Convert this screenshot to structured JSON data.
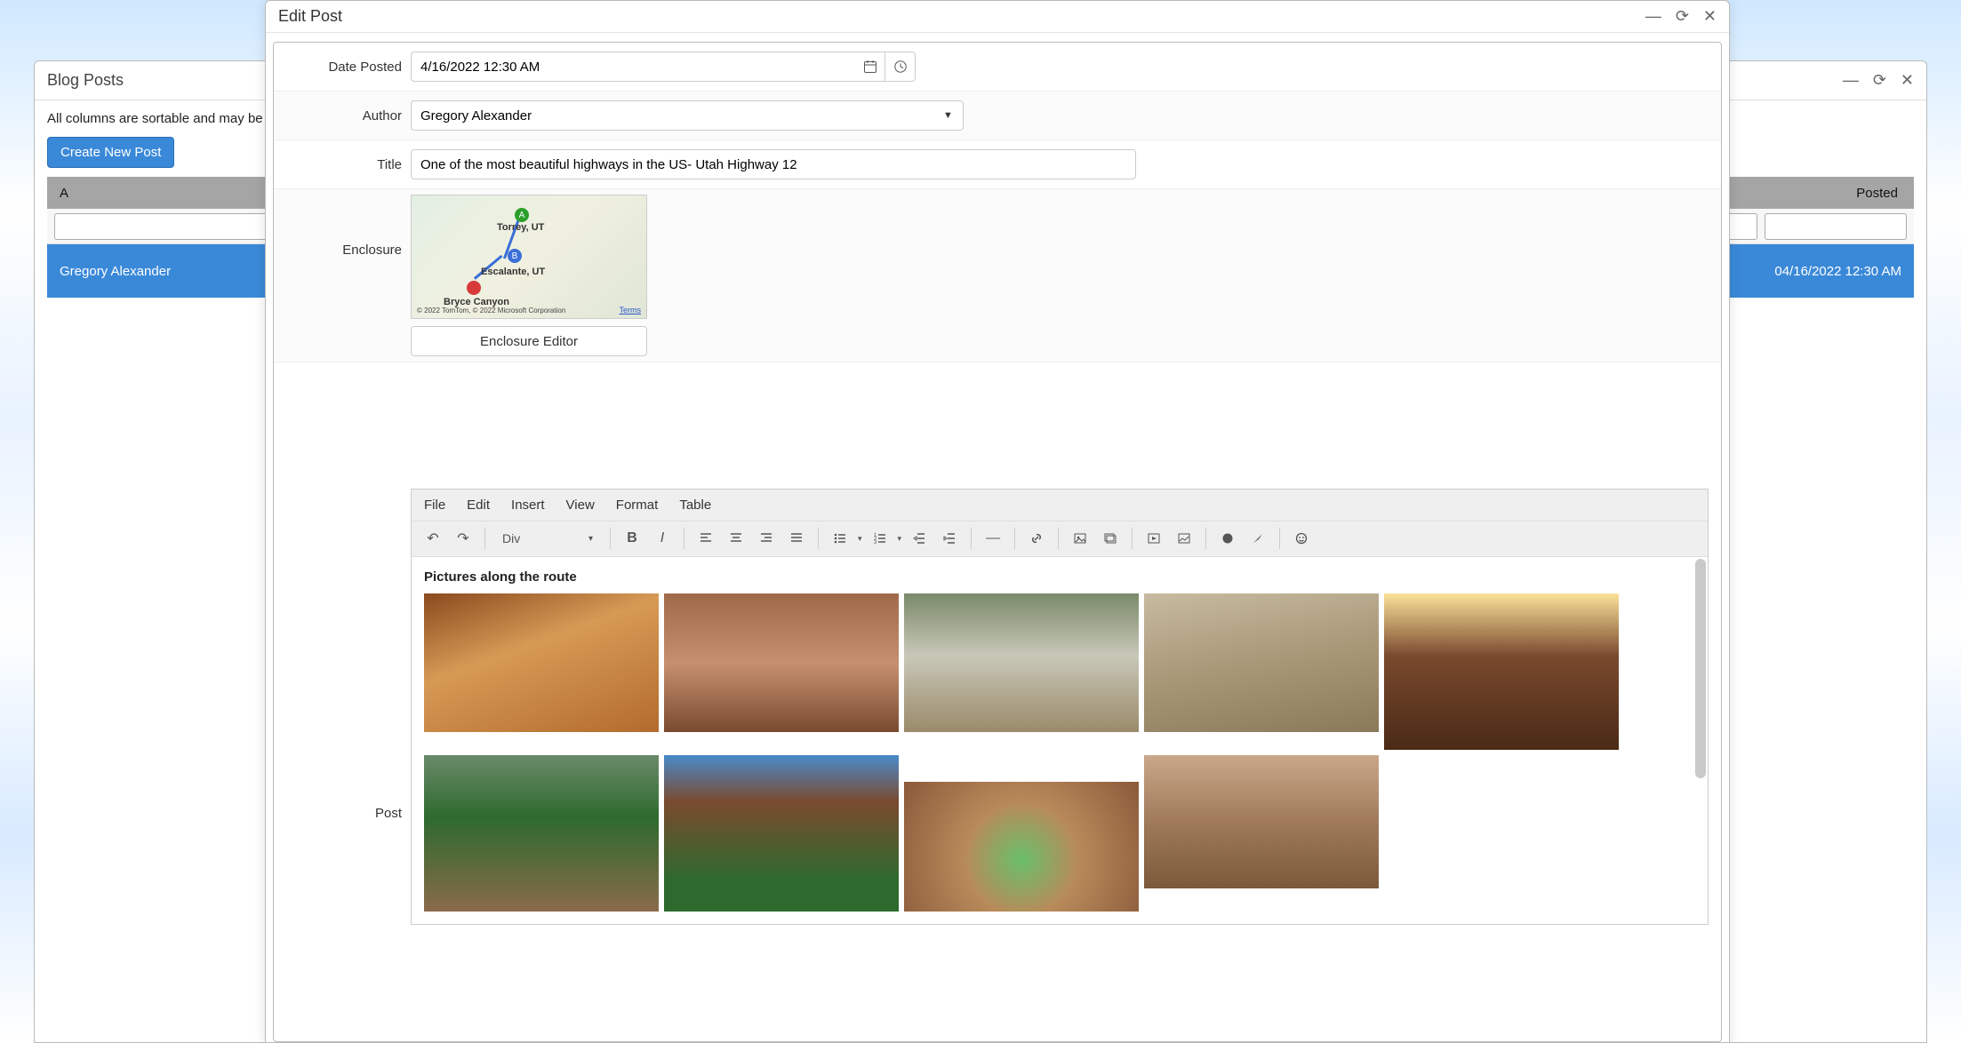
{
  "bgWindow": {
    "title": "Blog Posts",
    "helpText": "All columns are sortable and may be rearranged. To edit a post, double click on the row or click on the checkmark on the right of the page. There are extensive",
    "createBtn": "Create New Post",
    "columns": {
      "author_initial": "A",
      "posted": "Posted"
    },
    "filterPlaceholder": "",
    "row": {
      "author": "Gregory Alexander",
      "posted": "04/16/2022 12:30 AM"
    }
  },
  "editWindow": {
    "title": "Edit Post",
    "fields": {
      "datePosted": {
        "label": "Date Posted",
        "value": "4/16/2022 12:30 AM"
      },
      "author": {
        "label": "Author",
        "value": "Gregory Alexander"
      },
      "title": {
        "label": "Title",
        "value": "One of the most beautiful highways in the US- Utah Highway 12"
      },
      "enclosure": {
        "label": "Enclosure",
        "editorBtn": "Enclosure Editor",
        "map": {
          "a": "Torrey, UT",
          "b": "Escalante, UT",
          "c": "Bryce Canyon",
          "attrib": "© 2022 TomTom, © 2022 Microsoft Corporation",
          "terms": "Terms"
        }
      },
      "post": {
        "label": "Post"
      }
    },
    "editor": {
      "menus": [
        "File",
        "Edit",
        "Insert",
        "View",
        "Format",
        "Table"
      ],
      "formatSelect": "Div",
      "contentHeading": "Pictures along the route"
    }
  }
}
